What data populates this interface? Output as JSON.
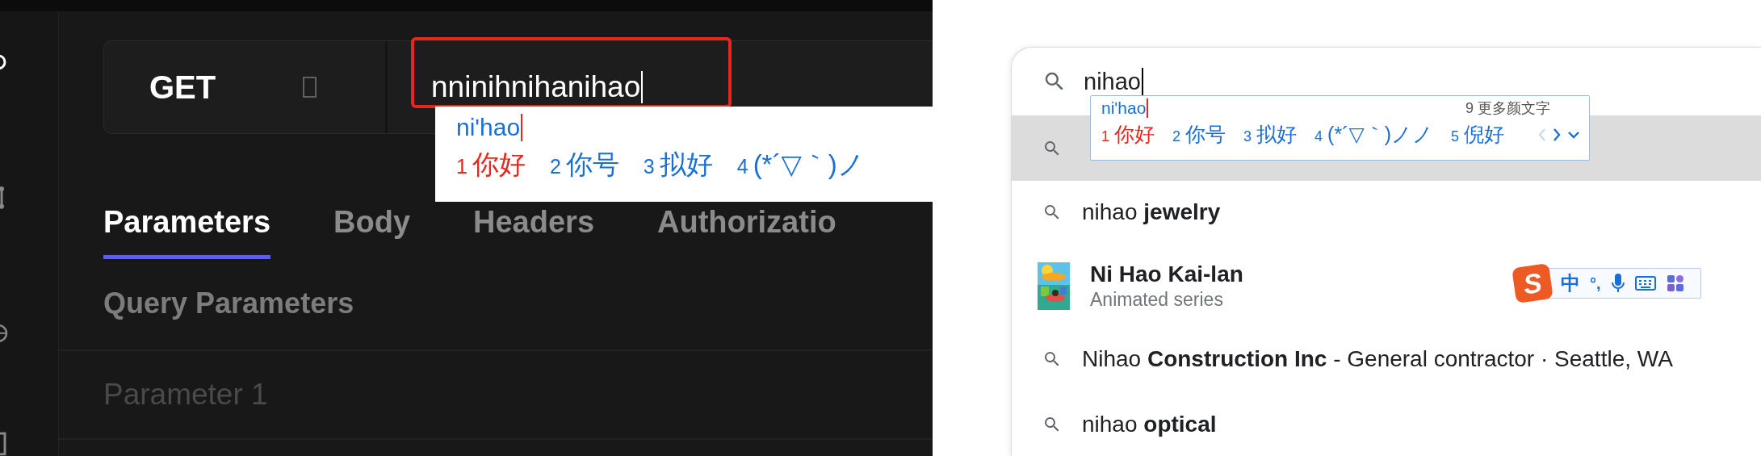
{
  "request_panel": {
    "method": "GET",
    "url": "nninihnihanihao",
    "ime": {
      "pinyin": "ni'hao",
      "candidates": [
        {
          "index": "1",
          "text": "你好",
          "selected": true
        },
        {
          "index": "2",
          "text": "你号",
          "selected": false
        },
        {
          "index": "3",
          "text": "拟好",
          "selected": false
        },
        {
          "index": "4",
          "text": "(*´▽｀)ノ",
          "selected": false
        }
      ]
    },
    "tabs": [
      {
        "label": "Parameters",
        "selected": true
      },
      {
        "label": "Body",
        "selected": false
      },
      {
        "label": "Headers",
        "selected": false
      },
      {
        "label": "Authorizatio",
        "selected": false
      }
    ],
    "section_title": "Query Parameters",
    "parameters": [
      {
        "placeholder": "Parameter 1"
      }
    ]
  },
  "search_panel": {
    "query": "nihao",
    "ime": {
      "pinyin": "ni'hao",
      "more_label": "9 更多颜文字",
      "prev_disabled": true,
      "candidates": [
        {
          "index": "1",
          "text": "你好",
          "selected": true
        },
        {
          "index": "2",
          "text": "你号",
          "selected": false
        },
        {
          "index": "3",
          "text": "拟好",
          "selected": false
        },
        {
          "index": "4",
          "text": "(*´▽｀)ノノ",
          "selected": false
        },
        {
          "index": "5",
          "text": "倪好",
          "selected": false
        }
      ]
    },
    "suggestions": [
      {
        "kind": "query",
        "selected": true
      },
      {
        "kind": "query",
        "text": "nihao **jewelry**",
        "selected": false
      },
      {
        "kind": "entity",
        "title": "Ni Hao Kai-lan",
        "subtitle": "Animated series",
        "selected": false
      },
      {
        "kind": "query",
        "text": "Nihao **Construction Inc** - General contractor · Seattle, WA",
        "selected": false
      },
      {
        "kind": "query",
        "text": "nihao **optical**",
        "selected": false
      }
    ],
    "ime_toolbar": {
      "logo": "S",
      "mode": "中",
      "punctuation": "°,"
    }
  }
}
